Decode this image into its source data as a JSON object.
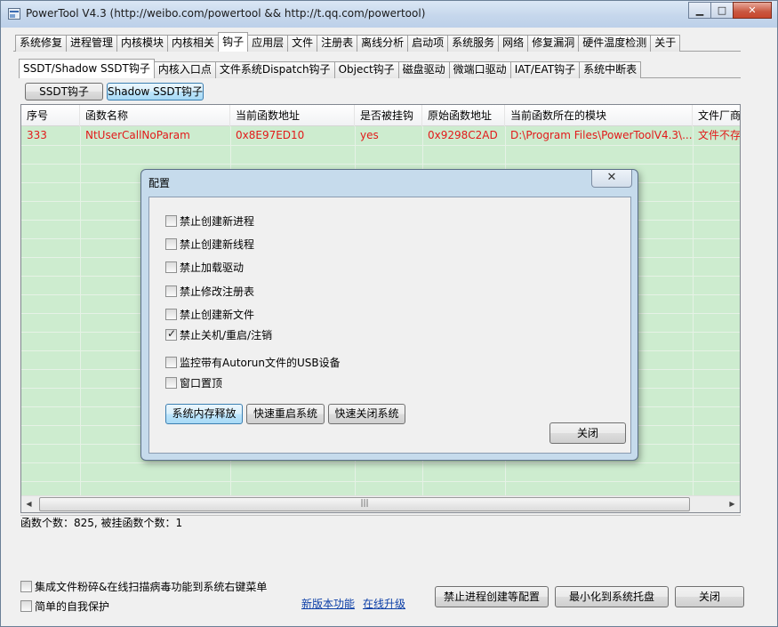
{
  "window": {
    "title": "PowerTool V4.3 (http://weibo.com/powertool && http://t.qq.com/powertool)"
  },
  "main_tabs": [
    "系统修复",
    "进程管理",
    "内核模块",
    "内核相关",
    "钩子",
    "应用层",
    "文件",
    "注册表",
    "离线分析",
    "启动项",
    "系统服务",
    "网络",
    "修复漏洞",
    "硬件温度检测",
    "关于"
  ],
  "sub_tabs": [
    "SSDT/Shadow SSDT钩子",
    "内核入口点",
    "文件系统Dispatch钩子",
    "Object钩子",
    "磁盘驱动",
    "微端口驱动",
    "IAT/EAT钩子",
    "系统中断表"
  ],
  "mode_buttons": {
    "ssdt": "SSDT钩子",
    "shadow": "Shadow SSDT钩子"
  },
  "table": {
    "columns": [
      "序号",
      "函数名称",
      "当前函数地址",
      "是否被挂钩",
      "原始函数地址",
      "当前函数所在的模块",
      "文件厂商"
    ],
    "rows": [
      [
        "333",
        "NtUserCallNoParam",
        "0x8E97ED10",
        "yes",
        "0x9298C2AD",
        "D:\\Program Files\\PowerToolV4.3\\...",
        "文件不存"
      ]
    ]
  },
  "status": "函数个数：825, 被挂函数个数：1",
  "dialog": {
    "title": "配置",
    "checkboxes": [
      {
        "label": "禁止创建新进程",
        "checked": false
      },
      {
        "label": "禁止创建新线程",
        "checked": false
      },
      {
        "label": "禁止加载驱动",
        "checked": false
      },
      {
        "label": "禁止修改注册表",
        "checked": false
      },
      {
        "label": "禁止创建新文件",
        "checked": false
      },
      {
        "label": "禁止关机/重启/注销",
        "checked": true
      },
      {
        "label": "监控带有Autorun文件的USB设备",
        "checked": false
      },
      {
        "label": "窗口置顶",
        "checked": false
      }
    ],
    "actions": [
      "系统内存释放",
      "快速重启系统",
      "快速关闭系统"
    ],
    "close_label": "关闭"
  },
  "bottom": {
    "options": [
      {
        "label": "集成文件粉碎&在线扫描病毒功能到系统右键菜单",
        "checked": false
      },
      {
        "label": "简单的自我保护",
        "checked": false
      }
    ],
    "links": [
      "新版本功能",
      "在线升级"
    ],
    "buttons": [
      "禁止进程创建等配置",
      "最小化到系统托盘",
      "关闭"
    ]
  }
}
